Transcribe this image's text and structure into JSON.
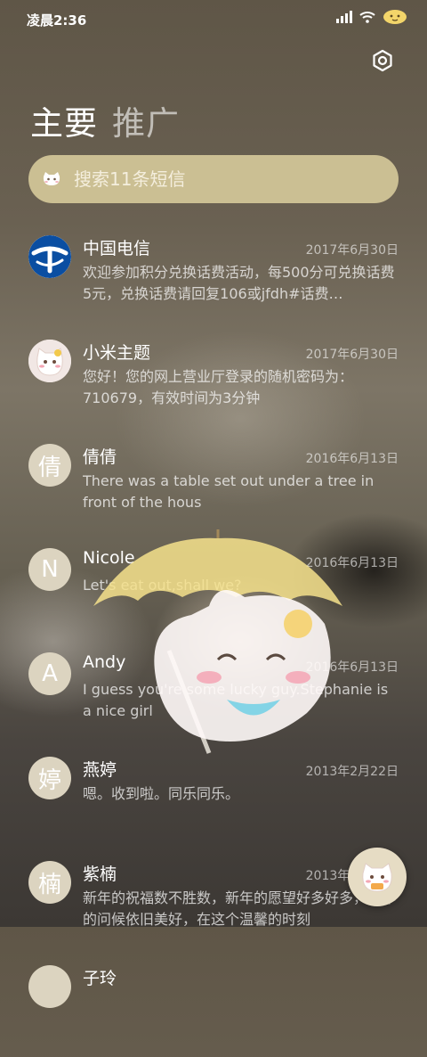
{
  "status_bar": {
    "time": "凌晨2:36"
  },
  "tabs": [
    {
      "label": "主要",
      "active": true
    },
    {
      "label": "推广",
      "active": false
    }
  ],
  "search": {
    "placeholder": "搜索11条短信"
  },
  "threads": [
    {
      "name": "中国电信",
      "date": "2017年6月30日",
      "preview": "欢迎参加积分兑换话费活动，每500分可兑换话费5元，兑换话费请回复106或jfdh#话费…",
      "avatar_text": "",
      "avatar_type": "china-telecom-logo"
    },
    {
      "name": "小米主题",
      "date": "2017年6月30日",
      "preview": "您好！您的网上营业厅登录的随机密码为：710679，有效时间为3分钟",
      "avatar_text": "",
      "avatar_type": "cat-sticker"
    },
    {
      "name": "倩倩",
      "date": "2016年6月13日",
      "preview": "There was a table set out under a tree in front of the hous",
      "avatar_text": "倩",
      "avatar_type": "letter"
    },
    {
      "name": "Nicole",
      "date": "2016年6月13日",
      "preview": "Let's eat out,shall we?",
      "avatar_text": "N",
      "avatar_type": "letter"
    },
    {
      "name": "Andy",
      "date": "2016年6月13日",
      "preview": "I guess you're some lucky guy.Stephanie is a nice girl",
      "avatar_text": "A",
      "avatar_type": "letter"
    },
    {
      "name": "燕婷",
      "date": "2013年2月22日",
      "preview": "嗯。收到啦。同乐同乐。",
      "avatar_text": "婷",
      "avatar_type": "letter"
    },
    {
      "name": "紫楠",
      "date": "2013年2月22日",
      "preview": "新年的祝福数不胜数，新年的愿望好多好多，新年的问候依旧美好，在这个温馨的时刻",
      "avatar_text": "楠",
      "avatar_type": "letter"
    },
    {
      "name": "子玲",
      "date": "",
      "preview": "",
      "avatar_text": "",
      "avatar_type": "letter"
    }
  ],
  "icons": {
    "settings": "gear-icon",
    "search": "cat-face-icon",
    "fab": "compose-cat-icon"
  },
  "colors": {
    "search_bg": "#cbbf93",
    "avatar_bg": "#dcd4c0"
  }
}
